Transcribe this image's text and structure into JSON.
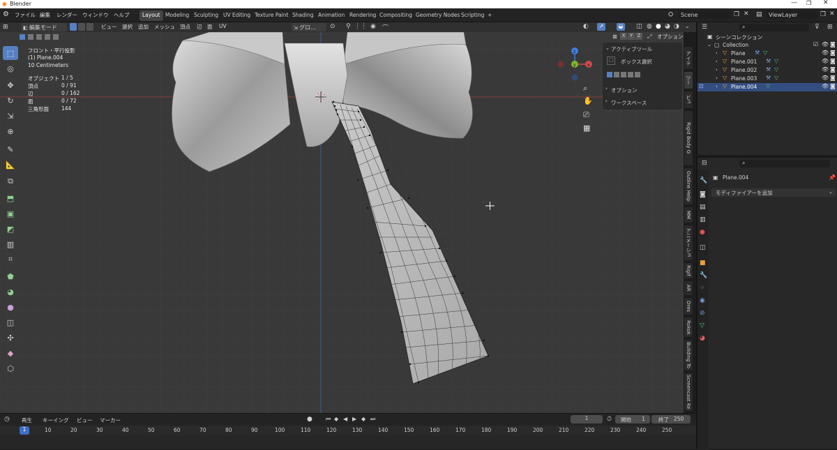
{
  "window": {
    "title": "Blender"
  },
  "menu": {
    "items": [
      "ファイル",
      "編集",
      "レンダー",
      "ウィンドウ",
      "ヘルプ"
    ]
  },
  "workspaces": {
    "tabs": [
      "Layout",
      "Modeling",
      "Sculpting",
      "UV Editing",
      "Texture Paint",
      "Shading",
      "Animation",
      "Rendering",
      "Compositing",
      "Geometry Nodes",
      "Scripting"
    ],
    "active": "Layout",
    "add": "+"
  },
  "scene": {
    "name": "Scene",
    "view_layer": "ViewLayer"
  },
  "viewport_header": {
    "mode": "編集モード",
    "menus": [
      "ビュー",
      "選択",
      "追加",
      "メッシュ",
      "頂点",
      "辺",
      "面",
      "UV"
    ],
    "transform": "グロ...",
    "options": "オプション",
    "axes": [
      "X",
      "Y",
      "Z"
    ]
  },
  "overlay": {
    "view_name": "フロント・平行投影",
    "object_name": "(1) Plane.004",
    "scale": "10 Centimeters",
    "stats": [
      {
        "label": "オブジェクト",
        "value": "1 / 5"
      },
      {
        "label": "頂点",
        "value": "0 / 91"
      },
      {
        "label": "辺",
        "value": "0 / 162"
      },
      {
        "label": "面",
        "value": "0 / 72"
      },
      {
        "label": "三角形面",
        "value": "144"
      }
    ]
  },
  "npanel": {
    "active_tool": "アクティブツール",
    "box_select": "ボックス選択",
    "options": "オプション",
    "workspace": "ワークスペース"
  },
  "side_tabs": [
    "アイテ",
    "ツー",
    "ビュ",
    "Rigid Body G",
    "Outline Help",
    "MM",
    "アニメーショ",
    "Rigif",
    "AR",
    "Dres",
    "Rokok",
    "Building To",
    "Screencast Ke"
  ],
  "outliner": {
    "root": "シーンコレクション",
    "collection": "Collection",
    "objects": [
      "Plane",
      "Plane.001",
      "Plane.002",
      "Plane.003",
      "Plane.004"
    ],
    "selected": "Plane.004"
  },
  "properties": {
    "object_name": "Plane.004",
    "add_modifier": "モディファイアーを追加"
  },
  "timeline": {
    "menus": [
      "再生",
      "キーイング",
      "ビュー",
      "マーカー"
    ],
    "current_frame": "1",
    "start_label": "開始",
    "start": "1",
    "end_label": "終了",
    "end": "250",
    "ticks": [
      "1",
      "10",
      "20",
      "30",
      "40",
      "50",
      "60",
      "70",
      "80",
      "90",
      "100",
      "110",
      "120",
      "130",
      "140",
      "150",
      "160",
      "170",
      "180",
      "190",
      "200",
      "210",
      "220",
      "230",
      "240",
      "250"
    ]
  },
  "colors": {
    "accent": "#5680c2",
    "x_axis": "#d04a4a",
    "y_axis": "#7fb82a",
    "z_axis": "#3f7fd9",
    "selected_row": "#334d80"
  }
}
